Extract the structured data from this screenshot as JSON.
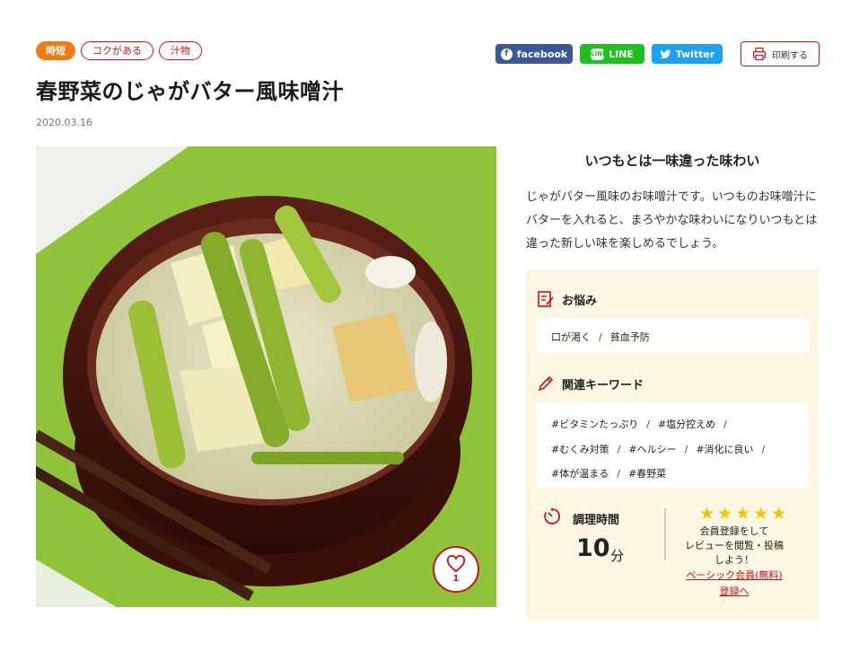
{
  "tags": [
    "時短",
    "コクがある",
    "汁物"
  ],
  "share": {
    "facebook": "facebook",
    "line": "LINE",
    "twitter": "Twitter",
    "facebook_icon": "facebook-icon",
    "line_icon": "line-icon",
    "twitter_icon": "twitter-icon"
  },
  "print": {
    "label": "印刷する",
    "icon": "printer-icon"
  },
  "recipe": {
    "title": "春野菜のじゃがバター風味噌汁",
    "date": "2020.03.16",
    "likes": "1"
  },
  "intro": {
    "heading": "いつもとは一味違った味わい",
    "body": "じゃがバター風味のお味噌汁です。いつものお味噌汁にバターを入れると、まろやかな味わいになりいつもとは違った新しい味を楽しめるでしょう。"
  },
  "concerns": {
    "heading": "お悩み",
    "items": [
      "口が渇く",
      "貧血予防"
    ],
    "sep": "/"
  },
  "keywords": {
    "heading": "関連キーワード",
    "items": [
      "#ビタミンたっぷり",
      "#塩分控えめ",
      "#むくみ対策",
      "#ヘルシー",
      "#消化に良い",
      "#体が温まる",
      "#春野菜"
    ],
    "sep": "/"
  },
  "cook_time": {
    "label": "調理時間",
    "value": "10",
    "unit": "分"
  },
  "review": {
    "stars": [
      "★",
      "★",
      "★",
      "★",
      "★"
    ],
    "text_lines": [
      "会員登録をして",
      "レビューを閲覧・投稿",
      "しよう！"
    ],
    "link_lines": [
      "ベーシック会員(無料)",
      "登録へ"
    ]
  },
  "colors": {
    "accent": "#c8161d",
    "tag_primary": "#f07a12",
    "panel_bg": "#fcf6e3",
    "facebook": "#3b5998",
    "line": "#1dc01d",
    "twitter": "#1da1f2",
    "star": "#f4c30e"
  }
}
